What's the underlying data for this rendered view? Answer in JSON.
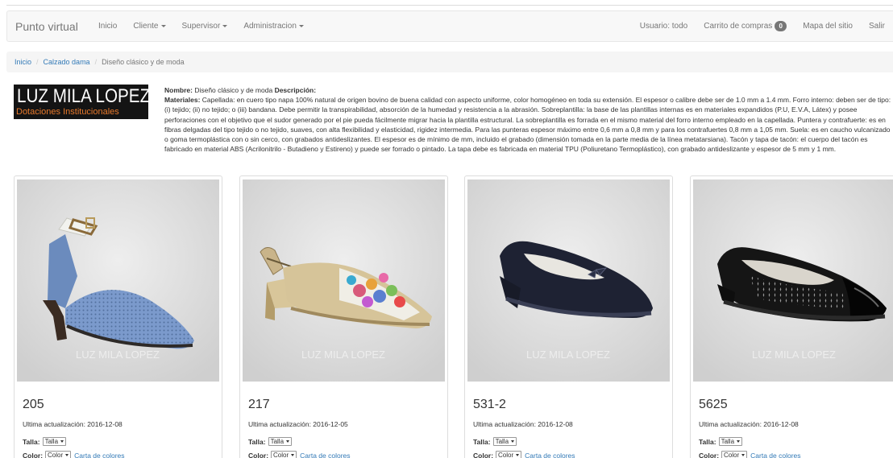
{
  "navbar": {
    "brand": "Punto virtual",
    "left_items": [
      {
        "label": "Inicio",
        "dropdown": false
      },
      {
        "label": "Cliente",
        "dropdown": true
      },
      {
        "label": "Supervisor",
        "dropdown": true
      },
      {
        "label": "Administracion",
        "dropdown": true
      }
    ],
    "user": "Usuario: todo",
    "cart_label": "Carrito de compras",
    "cart_count": "0",
    "sitemap": "Mapa del sitio",
    "logout": "Salir"
  },
  "breadcrumb": {
    "items": [
      "Inicio",
      "Calzado dama"
    ],
    "active": "Diseño clásico y de moda"
  },
  "logo": {
    "top_text": "LUZ MILA LOPEZ",
    "bottom_text": "Dotaciones Institucionales"
  },
  "description": {
    "name_label": "Nombre:",
    "name": "Diseño clásico y de moda",
    "desc_label": "Descripción:",
    "materials_label": "Materiales:",
    "materials": "Capellada: en cuero tipo napa 100% natural de origen bovino de buena calidad con aspecto uniforme, color homogéneo en toda su extensión. El espesor o calibre debe ser de 1.0 mm a 1.4 mm. Forro interno: deben ser de tipo: (i) tejido; (ii) no tejido; o (iii) bandana. Debe permitir la transpirabilidad, absorción de la humedad y resistencia a la abrasión. Sobreplantilla: la base de las plantillas internas es en materiales expandidos (P.U, E.V.A, Látex) y posee perforaciones con el objetivo que el sudor generado por el pie pueda fácilmente migrar hacia la plantilla estructural. La sobreplantilla es forrada en el mismo material del forro interno empleado en la capellada. Puntera y contrafuerte: es en fibras delgadas del tipo tejido o no tejido, suaves, con alta flexibilidad y elasticidad, rigidez intermedia. Para las punteras espesor máximo entre 0,6 mm a 0,8 mm y para los contrafuertes 0,8 mm a 1,05 mm. Suela: es en caucho vulcanizado o goma termoplástica con o sin cerco, con grabados antideslizantes. El espesor es de mínimo de mm, incluido el grabado (dimensión tomada en la parte media de la línea metatarsiana). Tacón y tapa de tacón: el cuerpo del tacón es fabricado en material ABS (Acrilonitrilo - Butadieno y Estireno) y puede ser forrado o pintado. La tapa debe es fabricada en material TPU (Poliuretano Termoplástico), con grabado antideslizante y espesor de 5 mm y 1 mm."
  },
  "labels": {
    "talla": "Talla:",
    "color": "Color:",
    "talla_select": "Talla",
    "color_select": "Color",
    "colors_link": "Carta de colores",
    "watermark": "LUZ MILA LOPEZ"
  },
  "products": [
    {
      "code": "205",
      "updated": "Ultima actualización: 2016-12-08",
      "image": "blue-perforated-ankle-strap-heel"
    },
    {
      "code": "217",
      "updated": "Ultima actualización: 2016-12-05",
      "image": "gold-slingback-floral-peep-toe"
    },
    {
      "code": "531-2",
      "updated": "Ultima actualización: 2016-12-08",
      "image": "navy-bow-wedge-flat"
    },
    {
      "code": "5625",
      "updated": "Ultima actualización: 2016-12-08",
      "image": "black-perforated-patent-toe-flat"
    }
  ],
  "colors": {
    "brand_blue": "#337ab7",
    "logo_orange": "#e8792b",
    "navbar_bg": "#f8f8f8"
  }
}
